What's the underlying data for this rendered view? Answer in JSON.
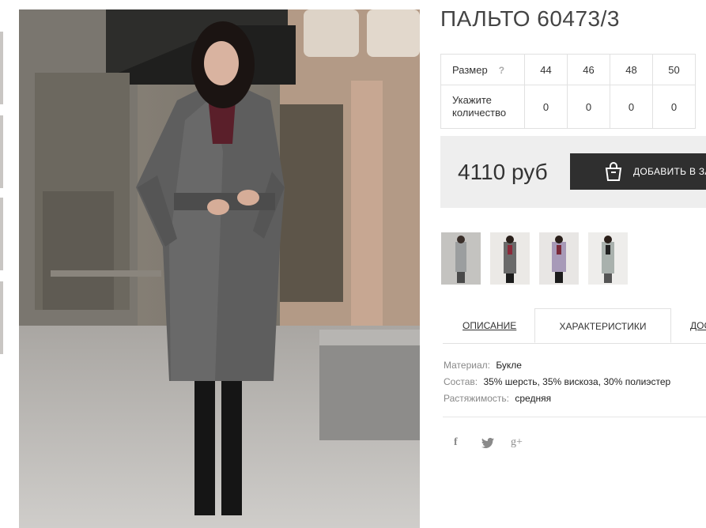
{
  "product": {
    "title": "ПАЛЬТО 60473/3"
  },
  "sizes": {
    "size_label": "Размер",
    "help_icon": "?",
    "qty_label_line1": "Укажите",
    "qty_label_line2": "количество",
    "values": [
      "44",
      "46",
      "48",
      "50"
    ],
    "quantities": [
      "0",
      "0",
      "0",
      "0"
    ]
  },
  "price": {
    "value": "4110 руб",
    "add_to_cart": "ДОБАВИТЬ В ЗАКАЗ"
  },
  "tabs": {
    "description": "ОПИСАНИЕ",
    "characteristics": "ХАРАКТЕРИСТИКИ",
    "delivery": "ДОСТАВКА"
  },
  "characteristics": [
    {
      "key": "Материал:",
      "value": "Букле"
    },
    {
      "key": "Состав:",
      "value": "35% шерсть, 35% вискоза, 30% полиэстер"
    },
    {
      "key": "Растяжимость:",
      "value": "средняя"
    }
  ],
  "social": {
    "facebook": "f",
    "twitter": "twitter-bird-icon",
    "google": "g+"
  },
  "colors": {
    "dark_button": "#2f2f2f",
    "price_bg": "#eeeeee",
    "border": "#e1e1e1"
  }
}
